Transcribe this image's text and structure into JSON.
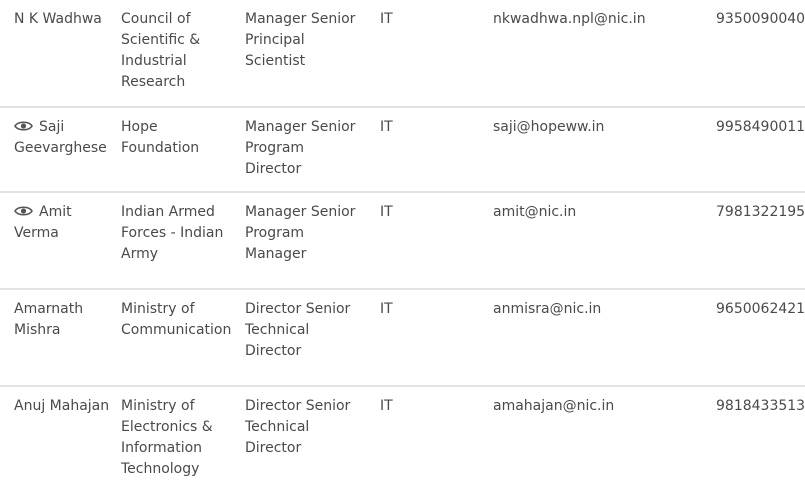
{
  "rows": [
    {
      "name": "N K Wadhwa",
      "has_view_icon": false,
      "organization": "Council of Scientific & Industrial Research",
      "designation": "Manager Senior Principal Scientist",
      "department": "IT",
      "email": "nkwadhwa.npl@nic.in",
      "phone": "9350090040"
    },
    {
      "name": "Saji Geevarghese",
      "has_view_icon": true,
      "organization": "Hope Foundation",
      "designation": "Manager Senior Program Director",
      "department": "IT",
      "email": "saji@hopeww.in",
      "phone": "9958490011"
    },
    {
      "name": "Amit Verma",
      "has_view_icon": true,
      "organization": "Indian Armed Forces - Indian Army",
      "designation": "Manager Senior Program Manager",
      "department": "IT",
      "email": "amit@nic.in",
      "phone": "7981322195"
    },
    {
      "name": "Amarnath Mishra",
      "has_view_icon": false,
      "organization": "Ministry of Communication",
      "designation": "Director Senior Technical Director",
      "department": "IT",
      "email": "anmisra@nic.in",
      "phone": "9650062421"
    },
    {
      "name": "Anuj Mahajan",
      "has_view_icon": false,
      "organization": "Ministry of Electronics & Information Technology",
      "designation": "Director Senior Technical Director",
      "department": "IT",
      "email": "amahajan@nic.in",
      "phone": "9818433513"
    }
  ],
  "colors": {
    "text": "#4a4a4a",
    "divider": "#e3e3e3",
    "icon": "#555555"
  },
  "icons": {
    "view": "eye-icon"
  }
}
